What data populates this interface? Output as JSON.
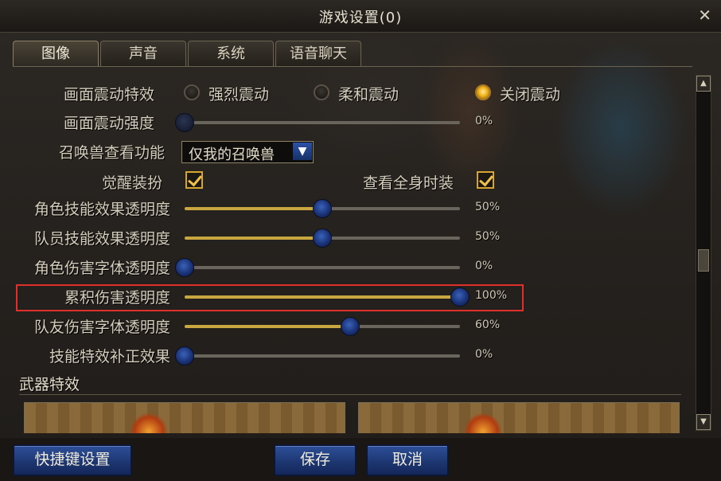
{
  "window": {
    "title": "游戏设置(0)",
    "close_glyph": "✕"
  },
  "tabs": [
    {
      "label": "图像",
      "active": true
    },
    {
      "label": "声音",
      "active": false
    },
    {
      "label": "系统",
      "active": false
    },
    {
      "label": "语音聊天",
      "active": false
    }
  ],
  "shake": {
    "label": "画面震动特效",
    "options": [
      "强烈震动",
      "柔和震动",
      "关闭震动"
    ],
    "selected": "关闭震动"
  },
  "shake_strength": {
    "label": "画面震动强度",
    "value_text": "0%",
    "value": 0
  },
  "summon": {
    "label": "召唤兽查看功能",
    "value": "仅我的召唤兽"
  },
  "awaken": {
    "label": "觉醒装扮",
    "checked": true
  },
  "fullbody": {
    "label": "查看全身时装",
    "checked": true
  },
  "sliders": [
    {
      "label": "角色技能效果透明度",
      "value_text": "50%",
      "value": 50
    },
    {
      "label": "队员技能效果透明度",
      "value_text": "50%",
      "value": 50
    },
    {
      "label": "角色伤害字体透明度",
      "value_text": "0%",
      "value": 0
    },
    {
      "label": "累积伤害透明度",
      "value_text": "100%",
      "value": 100
    },
    {
      "label": "队友伤害字体透明度",
      "value_text": "60%",
      "value": 60
    },
    {
      "label": "技能特效补正效果",
      "value_text": "0%",
      "value": 0
    }
  ],
  "weapon_effects": {
    "label": "武器特效"
  },
  "footer": {
    "hotkey": "快捷键设置",
    "save": "保存",
    "cancel": "取消"
  },
  "colors": {
    "accent_gold": "#c9a640",
    "button_blue": "#1c356f",
    "highlight_red": "#e0302c"
  }
}
